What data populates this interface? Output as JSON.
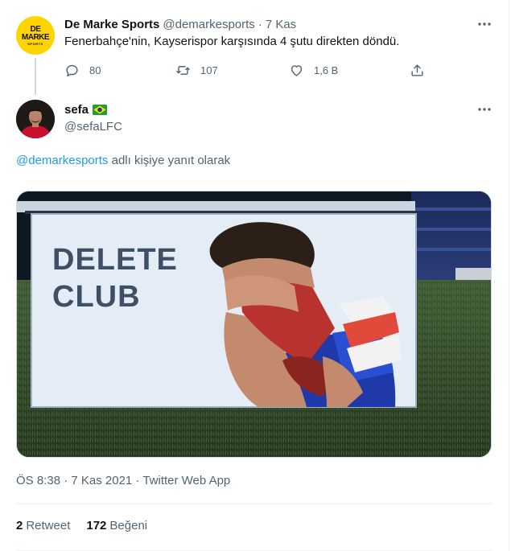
{
  "parent_tweet": {
    "avatar_logo_text": "DE MARKE",
    "avatar_logo_subtext": "SPORTS",
    "avatar_color": "#ffd400",
    "display_name": "De Marke Sports",
    "handle": "@demarkesports",
    "separator": "·",
    "date": "7 Kas",
    "text": "Fenerbahçe'nin, Kayserispor karşısında 4 şutu direkten döndü.",
    "more_icon": "more-horizontal-icon",
    "actions": {
      "reply": {
        "icon": "reply-icon",
        "count": "80"
      },
      "retweet": {
        "icon": "retweet-icon",
        "count": "107"
      },
      "like": {
        "icon": "like-icon",
        "count": "1,6 B"
      },
      "share": {
        "icon": "share-icon"
      }
    }
  },
  "main_tweet": {
    "display_name": "sefa",
    "badge_icon": "brazil-flag-icon",
    "handle": "@sefaLFC",
    "more_icon": "more-horizontal-icon",
    "reply_mention": "@demarkesports",
    "reply_suffix": "adlı kişiye yanıt olarak",
    "media": {
      "screen_line1": "DELETE",
      "screen_line2": "CLUB"
    },
    "timestamp": "ÖS 8:38 · 7 Kas 2021 · Twitter Web App",
    "stats": {
      "retweets_count": "2",
      "retweets_label": "Retweet",
      "likes_count": "172",
      "likes_label": "Beğeni"
    }
  },
  "colors": {
    "link": "#1d9bf0",
    "secondary_text": "#536471",
    "primary_text": "#0f1419",
    "divider": "#eff3f4"
  }
}
